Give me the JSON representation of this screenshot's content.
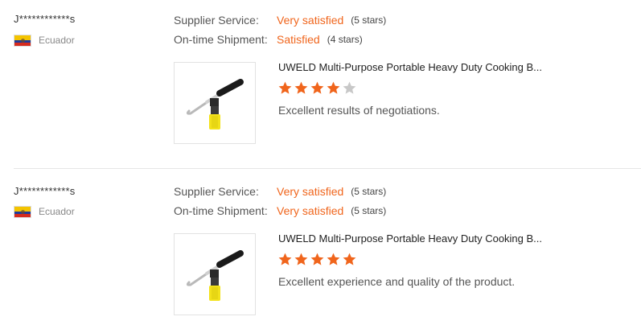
{
  "reviews": [
    {
      "buyer": "J************s",
      "country": "Ecuador",
      "supplier_service": {
        "label": "Supplier Service:",
        "value": "Very satisfied",
        "stars_text": "(5 stars)"
      },
      "shipment": {
        "label": "On-time Shipment:",
        "value": "Satisfied",
        "stars_text": "(4 stars)"
      },
      "product_title": "UWELD Multi-Purpose Portable Heavy Duty Cooking B...",
      "rating": 4,
      "rating_max": 5,
      "comment": "Excellent results of negotiations."
    },
    {
      "buyer": "J************s",
      "country": "Ecuador",
      "supplier_service": {
        "label": "Supplier Service:",
        "value": "Very satisfied",
        "stars_text": "(5 stars)"
      },
      "shipment": {
        "label": "On-time Shipment:",
        "value": "Very satisfied",
        "stars_text": "(5 stars)"
      },
      "product_title": "UWELD Multi-Purpose Portable Heavy Duty Cooking B...",
      "rating": 5,
      "rating_max": 5,
      "comment": "Excellent experience and quality of the product."
    }
  ],
  "colors": {
    "accent": "#f0651c",
    "star_off": "#c8c8c8"
  },
  "icons": {
    "flag": "ecuador-flag-icon",
    "star": "star-icon",
    "product": "torch-product-image"
  }
}
